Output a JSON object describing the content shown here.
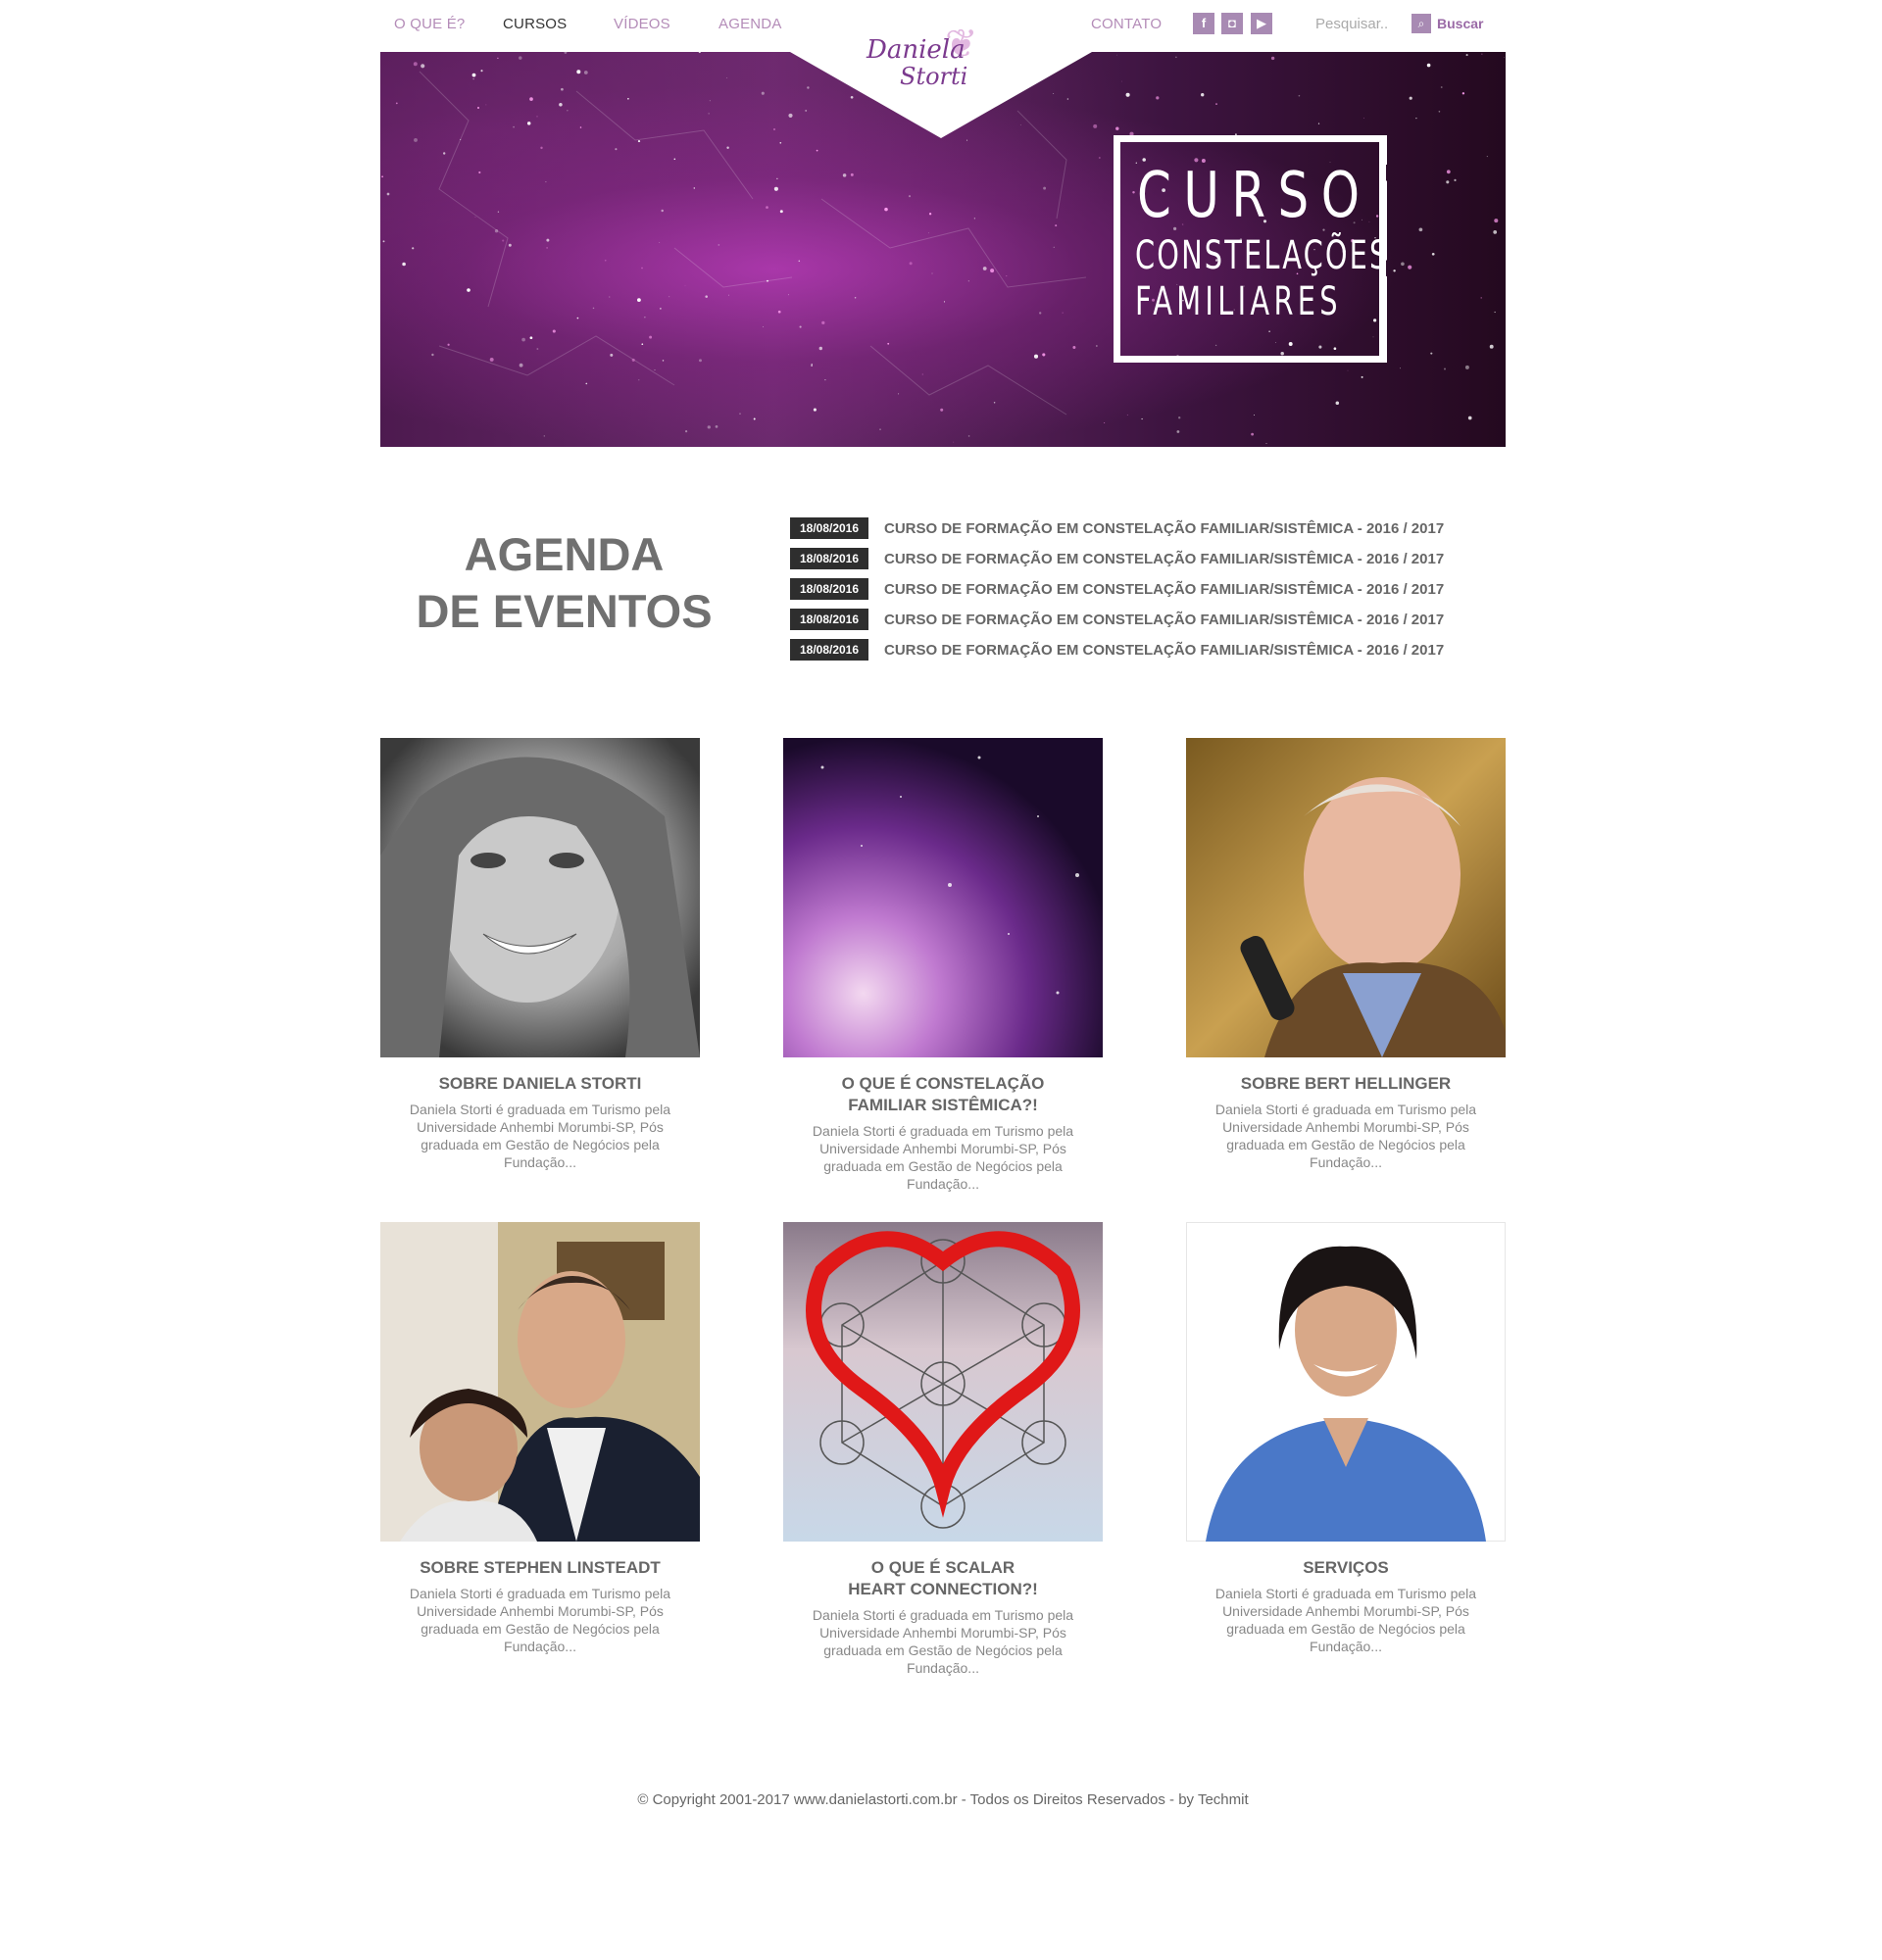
{
  "nav": {
    "items": [
      {
        "label": "O QUE É?",
        "active": false
      },
      {
        "label": "CURSOS",
        "active": true
      },
      {
        "label": "VÍDEOS",
        "active": false
      },
      {
        "label": "AGENDA",
        "active": false
      }
    ],
    "contact_label": "CONTATO",
    "social": [
      {
        "icon": "facebook-icon",
        "glyph": "f"
      },
      {
        "icon": "instagram-icon",
        "glyph": "◘"
      },
      {
        "icon": "youtube-icon",
        "glyph": "▶"
      }
    ],
    "search_placeholder": "Pesquisar..",
    "search_button": "Buscar"
  },
  "logo": {
    "line1": "Daniela",
    "line2": "Storti"
  },
  "hero": {
    "line1": "CURSO",
    "line2": "CONSTELAÇÕES",
    "line3": "FAMILIARES"
  },
  "agenda": {
    "title_line1": "AGENDA",
    "title_line2": "DE EVENTOS",
    "events": [
      {
        "date": "18/08/2016",
        "title": "CURSO DE FORMAÇÃO EM CONSTELAÇÃO FAMILIAR/SISTÊMICA - 2016 / 2017"
      },
      {
        "date": "18/08/2016",
        "title": "CURSO DE FORMAÇÃO EM CONSTELAÇÃO FAMILIAR/SISTÊMICA - 2016 / 2017"
      },
      {
        "date": "18/08/2016",
        "title": "CURSO DE FORMAÇÃO EM CONSTELAÇÃO FAMILIAR/SISTÊMICA - 2016 / 2017"
      },
      {
        "date": "18/08/2016",
        "title": "CURSO DE FORMAÇÃO EM CONSTELAÇÃO FAMILIAR/SISTÊMICA - 2016 / 2017"
      },
      {
        "date": "18/08/2016",
        "title": "CURSO DE FORMAÇÃO EM CONSTELAÇÃO FAMILIAR/SISTÊMICA - 2016 / 2017"
      }
    ]
  },
  "cards": [
    {
      "title": "SOBRE DANIELA STORTI",
      "desc": "Daniela Storti é graduada em Turismo pela Universidade Anhembi Morumbi-SP, Pós graduada em Gestão de Negócios pela Fundação..."
    },
    {
      "title": "O QUE É CONSTELAÇÃO\nFAMILIAR SISTÊMICA?!",
      "desc": "Daniela Storti é graduada em Turismo pela Universidade Anhembi Morumbi-SP, Pós graduada em Gestão de Negócios pela Fundação..."
    },
    {
      "title": "SOBRE BERT HELLINGER",
      "desc": "Daniela Storti é graduada em Turismo pela Universidade Anhembi Morumbi-SP, Pós graduada em Gestão de Negócios pela Fundação..."
    },
    {
      "title": "SOBRE STEPHEN LINSTEADT",
      "desc": "Daniela Storti é graduada em Turismo pela Universidade Anhembi Morumbi-SP, Pós graduada em Gestão de Negócios pela Fundação..."
    },
    {
      "title": "O QUE É SCALAR\nHEART CONNECTION?!",
      "desc": "Daniela Storti é graduada em Turismo pela Universidade Anhembi Morumbi-SP, Pós graduada em Gestão de Negócios pela Fundação..."
    },
    {
      "title": "SERVIÇOS",
      "desc": "Daniela Storti é graduada em Turismo pela Universidade Anhembi Morumbi-SP, Pós graduada em Gestão de Negócios pela Fundação..."
    }
  ],
  "footer": {
    "text": "© Copyright 2001-2017 www.danielastorti.com.br - Todos os Direitos Reservados - by Techmit"
  },
  "colors": {
    "accent": "#a88ab3",
    "nav_text": "#b48cb8",
    "heading": "#707070",
    "date_badge": "#2e2e2e"
  }
}
